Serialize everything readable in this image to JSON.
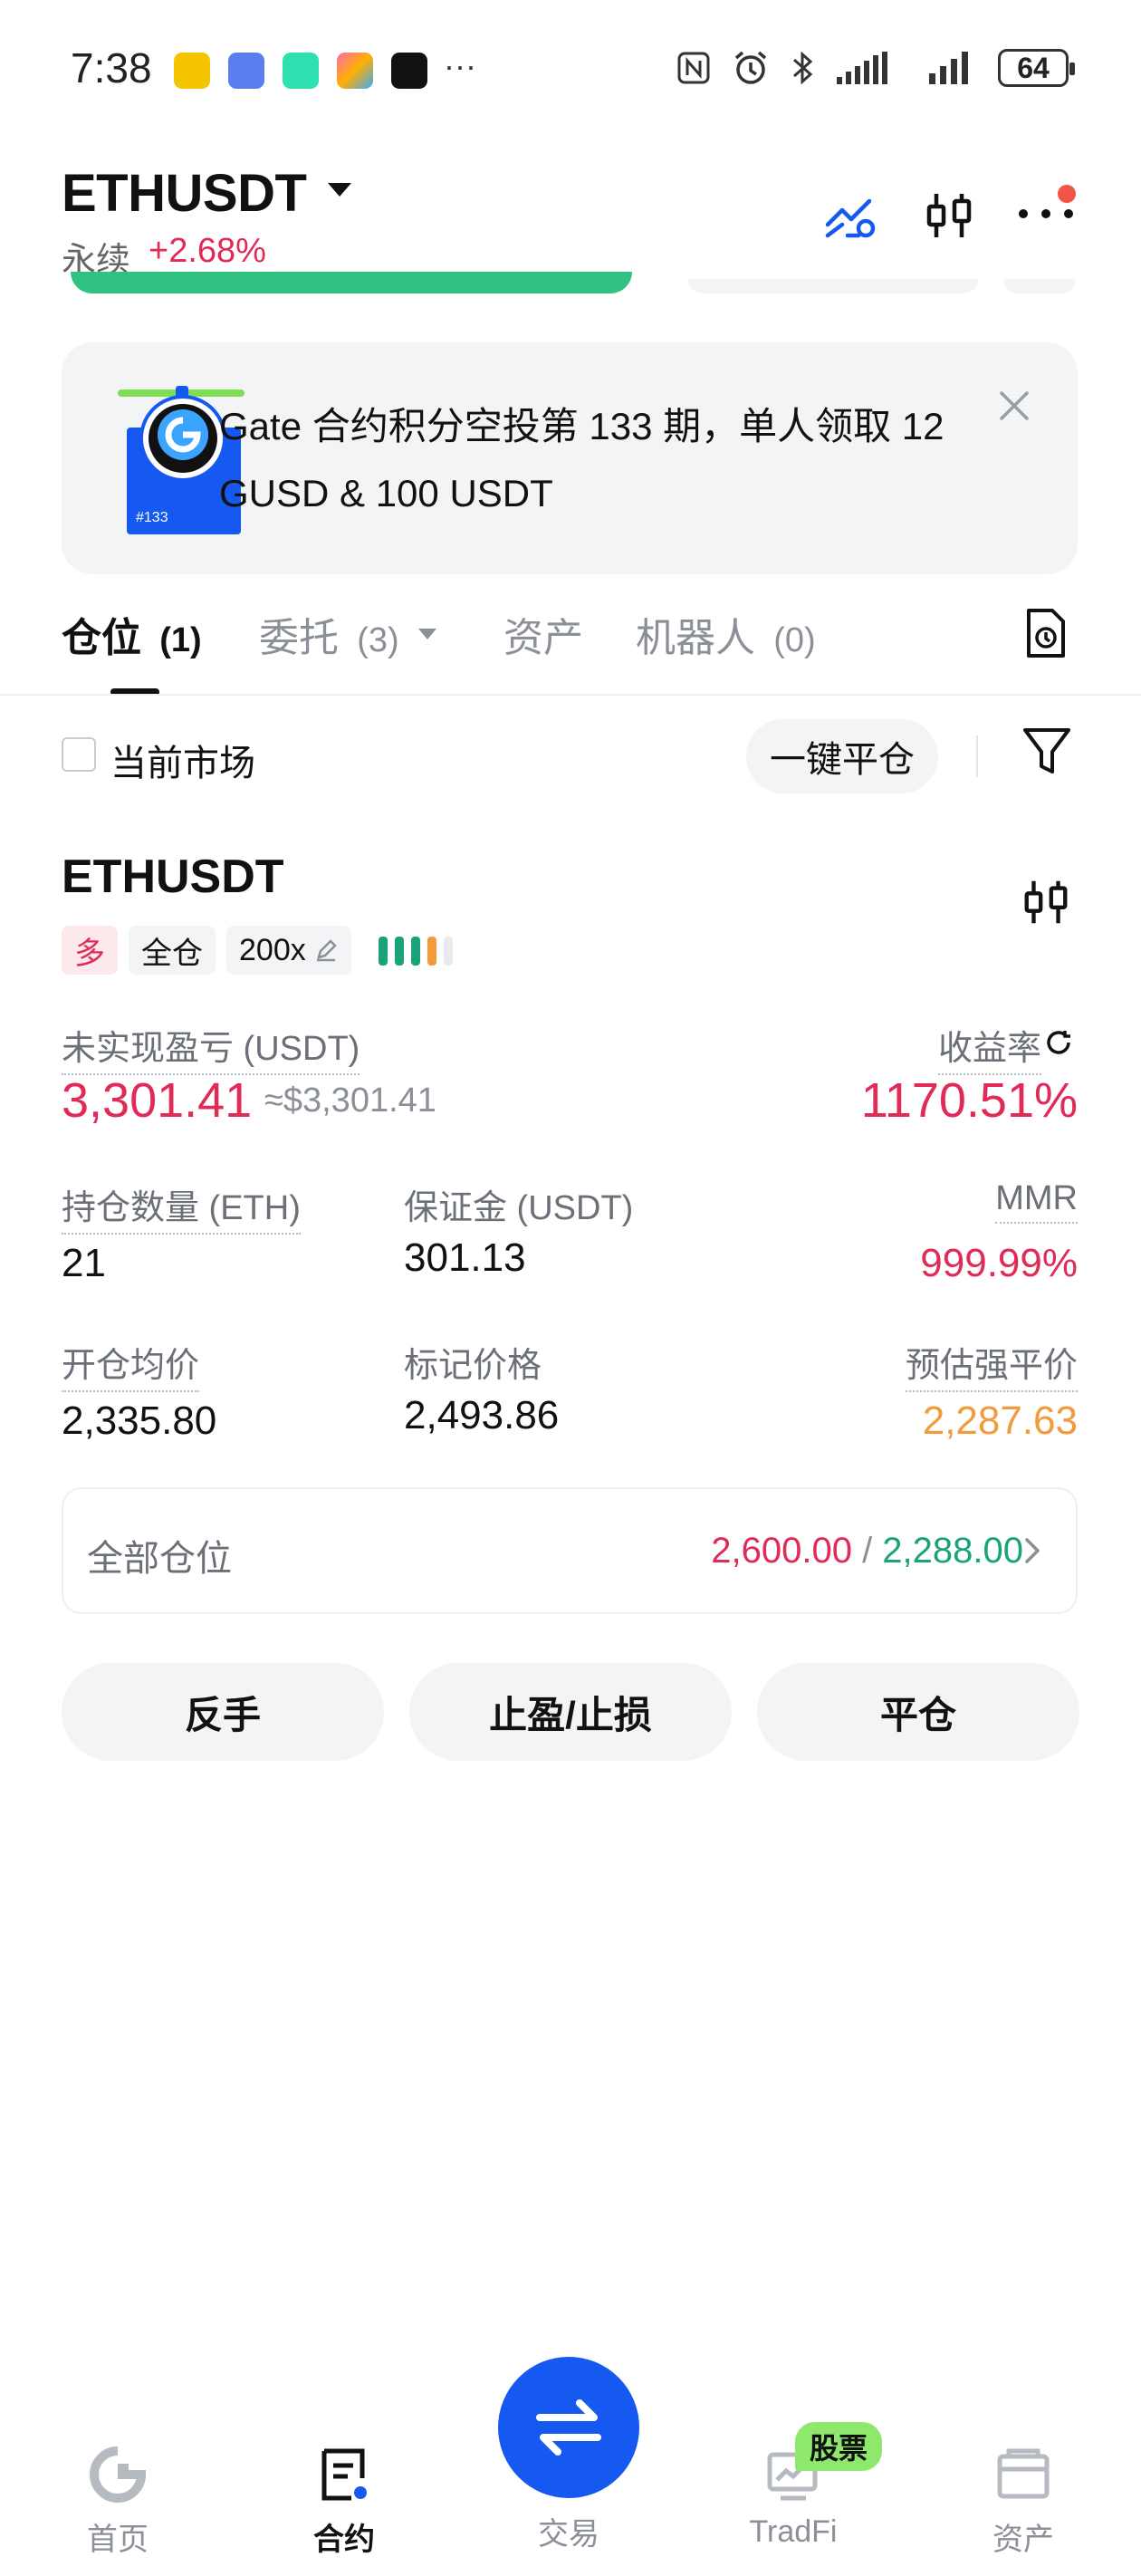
{
  "status_bar": {
    "time": "7:38",
    "dots": "···",
    "battery": "64"
  },
  "header": {
    "pair": "ETHUSDT",
    "contract_type": "永续",
    "change": "+2.68%",
    "icons": [
      "chart-compare-icon",
      "candlestick-icon",
      "more-icon"
    ]
  },
  "banner": {
    "text": "Gate 合约积分空投第 133 期，单人领取 12 GUSD & 100 USDT",
    "image_tag": "#133"
  },
  "tabs": [
    {
      "label": "仓位",
      "count": "(1)"
    },
    {
      "label": "委托",
      "count": "(3)"
    },
    {
      "label": "资产",
      "count": ""
    },
    {
      "label": "机器人",
      "count": "(0)"
    }
  ],
  "filter": {
    "current_market_label": "当前市场",
    "close_all_label": "一键平仓"
  },
  "position": {
    "symbol": "ETHUSDT",
    "side": "多",
    "margin_mode": "全仓",
    "leverage": "200x",
    "unrealized_pnl_label": "未实现盈亏 (USDT)",
    "unrealized_pnl": "3,301.41",
    "unrealized_pnl_usd": "≈$3,301.41",
    "roe_label": "收益率",
    "roe": "1170.51%",
    "size_label": "持仓数量 (ETH)",
    "size": "21",
    "margin_label": "保证金 (USDT)",
    "margin": "301.13",
    "mmr_label": "MMR",
    "mmr": "999.99%",
    "entry_label": "开仓均价",
    "entry": "2,335.80",
    "mark_label": "标记价格",
    "mark": "2,493.86",
    "liq_label": "预估强平价",
    "liq": "2,287.63",
    "all_positions_label": "全部仓位",
    "tp_value": "2,600.00",
    "separator": " / ",
    "sl_value": "2,288.00"
  },
  "actions": {
    "reverse": "反手",
    "tpsl": "止盈/止损",
    "close": "平仓"
  },
  "bottom_nav": {
    "home": "首页",
    "futures": "合约",
    "trade": "交易",
    "tradfi": "TradFi",
    "tradfi_badge": "股票",
    "assets": "资产"
  },
  "colors": {
    "red": "#e02b57",
    "green": "#1aa37a",
    "orange": "#f39a3c",
    "blue": "#1659f0"
  }
}
